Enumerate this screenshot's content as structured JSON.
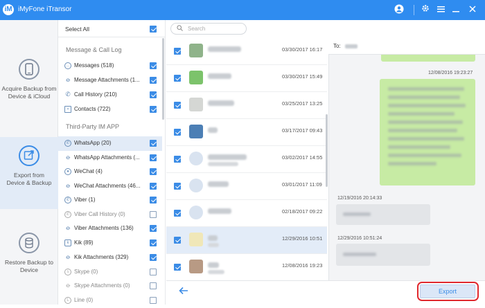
{
  "titlebar": {
    "title": "iMyFone iTransor",
    "logo_text": "iM",
    "icons": [
      "user-icon",
      "gear-icon",
      "menu-icon",
      "minimize-icon",
      "close-icon"
    ]
  },
  "nav": [
    {
      "label1": "Acquire Backup from",
      "label2": "Device & iCloud",
      "icon": "phone-icon"
    },
    {
      "label1": "Export from",
      "label2": "Device & Backup",
      "icon": "export-icon"
    },
    {
      "label1": "Restore Backup to",
      "label2": "Device",
      "icon": "database-icon"
    }
  ],
  "categories": {
    "select_all": "Select All",
    "section1": "Message & Call Log",
    "section2": "Third-Party IM APP",
    "items": [
      {
        "label": "Messages (518)",
        "checked": true
      },
      {
        "label": "Message Attachments (1...",
        "checked": true
      },
      {
        "label": "Call History (210)",
        "checked": true
      },
      {
        "label": "Contacts (722)",
        "checked": true
      },
      {
        "label": "WhatsApp (20)",
        "checked": true
      },
      {
        "label": "WhatsApp Attachments (...",
        "checked": true
      },
      {
        "label": "WeChat (4)",
        "checked": true
      },
      {
        "label": "WeChat Attachments (46...",
        "checked": true
      },
      {
        "label": "Viber (1)",
        "checked": true
      },
      {
        "label": "Viber Call History (0)",
        "checked": false
      },
      {
        "label": "Viber Attachments (136)",
        "checked": true
      },
      {
        "label": "Kik (89)",
        "checked": true
      },
      {
        "label": "Kik Attachments (329)",
        "checked": true
      },
      {
        "label": "Skype (0)",
        "checked": false
      },
      {
        "label": "Skype Attachments (0)",
        "checked": false
      },
      {
        "label": "Line (0)",
        "checked": false
      }
    ]
  },
  "search": {
    "placeholder": "Search"
  },
  "messages": [
    {
      "date": "03/30/2017 16:17"
    },
    {
      "date": "03/30/2017 15:49"
    },
    {
      "date": "03/25/2017 13:25"
    },
    {
      "date": "03/17/2017 09:43"
    },
    {
      "date": "03/02/2017 14:55"
    },
    {
      "date": "03/01/2017 11:09"
    },
    {
      "date": "02/18/2017 09:22"
    },
    {
      "date": "12/29/2016 10:51"
    },
    {
      "date": "12/08/2016 19:23"
    }
  ],
  "chat": {
    "to_label": "To:",
    "timestamps": [
      "12/08/2016 19:23:27",
      "12/19/2016 20:14:33",
      "12/29/2016 10:51:24"
    ]
  },
  "footer": {
    "export_label": "Export",
    "back_icon": "back-arrow-icon"
  }
}
